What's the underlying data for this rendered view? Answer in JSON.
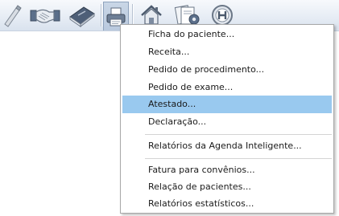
{
  "toolbar": {
    "buttons": [
      {
        "icon": "pen-icon"
      },
      {
        "icon": "handshake-icon"
      },
      {
        "icon": "book-icon"
      },
      {
        "icon": "printer-icon"
      },
      {
        "icon": "house-icon"
      },
      {
        "icon": "settings-icon"
      },
      {
        "icon": "hospital-icon"
      }
    ]
  },
  "menu": {
    "items": [
      {
        "label": "Ficha do paciente..."
      },
      {
        "label": "Receita..."
      },
      {
        "label": "Pedido de procedimento..."
      },
      {
        "label": "Pedido de exame..."
      },
      {
        "label": "Atestado..."
      },
      {
        "label": "Declaração..."
      },
      {
        "label": "Relatórios da Agenda Inteligente..."
      },
      {
        "label": "Fatura para convênios..."
      },
      {
        "label": "Relação de pacientes..."
      },
      {
        "label": "Relatórios estatísticos..."
      }
    ],
    "highlighted_index": 4,
    "highlight_color": "#99c9ef"
  }
}
